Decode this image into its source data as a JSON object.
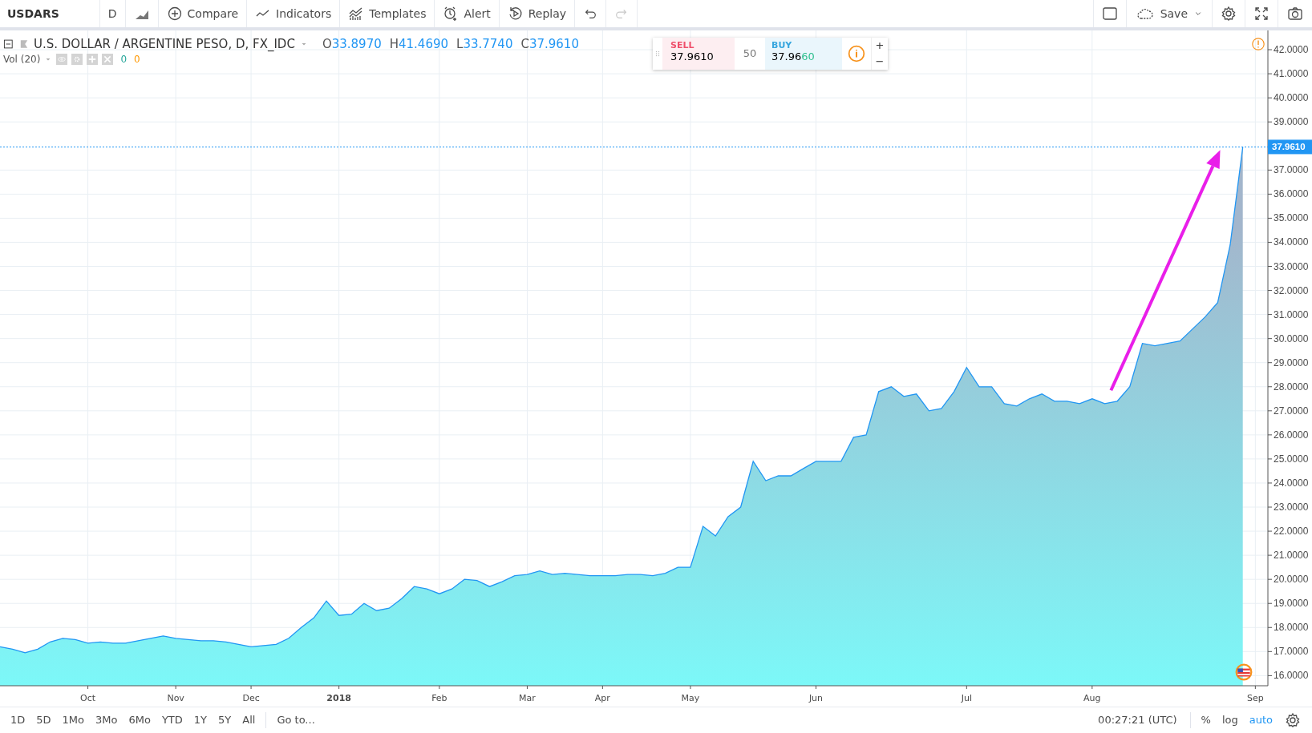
{
  "toolbar": {
    "symbol": "USDARS",
    "interval": "D",
    "buttons": [
      {
        "label": "Compare",
        "kind": "compare"
      },
      {
        "label": "Indicators",
        "kind": "indicators"
      },
      {
        "label": "Templates",
        "kind": "templates"
      },
      {
        "label": "Alert",
        "kind": "alert"
      },
      {
        "label": "Replay",
        "kind": "replay"
      }
    ],
    "undo": {
      "disabled": false
    },
    "redo": {
      "disabled": true
    },
    "save": {
      "label": "Save"
    }
  },
  "legend": {
    "title": "U.S. DOLLAR / ARGENTINE PESO, D, FX_IDC",
    "ohlc": [
      {
        "key": "O",
        "value": "33.8970"
      },
      {
        "key": "H",
        "value": "41.4690"
      },
      {
        "key": "L",
        "value": "33.7740"
      },
      {
        "key": "C",
        "value": "37.9610"
      }
    ],
    "study": {
      "label": "Vol (20)",
      "values": [
        {
          "value": "0",
          "color": "#26a69a"
        },
        {
          "value": "0",
          "color": "#ff9800"
        }
      ]
    }
  },
  "trade": {
    "sell": {
      "label": "SELL",
      "price": "37.9610"
    },
    "spread": "50",
    "buy": {
      "label": "BUY",
      "price_main": "37.96",
      "price_pips": "60"
    },
    "plus": "+",
    "minus": "−"
  },
  "chart": {
    "chart_data": {
      "type": "area",
      "categories": [
        null,
        null,
        null,
        null,
        null,
        null,
        null,
        "Oct",
        null,
        null,
        null,
        null,
        null,
        null,
        "Nov",
        null,
        null,
        null,
        null,
        null,
        "Dec",
        null,
        null,
        null,
        null,
        null,
        null,
        "2018",
        null,
        null,
        null,
        null,
        null,
        null,
        null,
        "Feb",
        null,
        null,
        null,
        null,
        null,
        null,
        "Mar",
        null,
        null,
        null,
        null,
        null,
        "Apr",
        null,
        null,
        null,
        null,
        null,
        null,
        "May",
        null,
        null,
        null,
        null,
        null,
        null,
        null,
        null,
        null,
        "Jun",
        null,
        null,
        null,
        null,
        null,
        null,
        null,
        null,
        null,
        null,
        null,
        "Jul",
        null,
        null,
        null,
        null,
        null,
        null,
        null,
        null,
        null,
        "Aug",
        null,
        null,
        null,
        null,
        null,
        null,
        null,
        null,
        null,
        null,
        null,
        null,
        "Sep"
      ],
      "series": [
        {
          "color": "#2196f3",
          "values": [
            17.2,
            17.1,
            16.95,
            17.1,
            17.4,
            17.55,
            17.5,
            17.35,
            17.4,
            17.35,
            17.35,
            17.45,
            17.55,
            17.65,
            17.55,
            17.5,
            17.45,
            17.45,
            17.4,
            17.3,
            17.2,
            17.25,
            17.3,
            17.55,
            18.0,
            18.4,
            19.1,
            18.5,
            18.55,
            19.0,
            18.7,
            18.8,
            19.2,
            19.7,
            19.6,
            19.4,
            19.6,
            20.0,
            19.95,
            19.7,
            19.9,
            20.15,
            20.2,
            20.35,
            20.2,
            20.25,
            20.2,
            20.15,
            20.15,
            20.15,
            20.2,
            20.2,
            20.15,
            20.25,
            20.5,
            20.5,
            22.2,
            21.8,
            22.6,
            23.0,
            24.9,
            24.1,
            24.3,
            24.3,
            24.6,
            24.9,
            24.9,
            24.9,
            25.9,
            26.0,
            27.8,
            28.0,
            27.6,
            27.7,
            27.0,
            27.1,
            27.8,
            28.8,
            28.0,
            28.0,
            27.3,
            27.2,
            27.5,
            27.7,
            27.4,
            27.4,
            27.3,
            27.5,
            27.3,
            27.4,
            28.0,
            29.8,
            29.7,
            29.8,
            29.9,
            30.4,
            30.9,
            31.5,
            33.9,
            37.96,
            null
          ]
        }
      ],
      "ylim": [
        15.58,
        42.8
      ],
      "yticks": [
        {
          "value": 16,
          "label": "16.0000"
        },
        {
          "value": 17,
          "label": "17.0000"
        },
        {
          "value": 18,
          "label": "18.0000"
        },
        {
          "value": 19,
          "label": "19.0000"
        },
        {
          "value": 20,
          "label": "20.0000"
        },
        {
          "value": 21,
          "label": "21.0000"
        },
        {
          "value": 22,
          "label": "22.0000"
        },
        {
          "value": 23,
          "label": "23.0000"
        },
        {
          "value": 24,
          "label": "24.0000"
        },
        {
          "value": 25,
          "label": "25.0000"
        },
        {
          "value": 26,
          "label": "26.0000"
        },
        {
          "value": 27,
          "label": "27.0000"
        },
        {
          "value": 28,
          "label": "28.0000"
        },
        {
          "value": 29,
          "label": "29.0000"
        },
        {
          "value": 30,
          "label": "30.0000"
        },
        {
          "value": 31,
          "label": "31.0000"
        },
        {
          "value": 32,
          "label": "32.0000"
        },
        {
          "value": 33,
          "label": "33.0000"
        },
        {
          "value": 34,
          "label": "34.0000"
        },
        {
          "value": 35,
          "label": "35.0000"
        },
        {
          "value": 36,
          "label": "36.0000"
        },
        {
          "value": 37,
          "label": "37.0000"
        },
        {
          "value": 39,
          "label": "39.0000"
        },
        {
          "value": 40,
          "label": "40.0000"
        },
        {
          "value": 41,
          "label": "41.0000"
        },
        {
          "value": 42,
          "label": "42.0000"
        }
      ],
      "grid": true,
      "ref_lines": [
        {
          "axis": "y",
          "value": 37.961,
          "label": "37.9610"
        }
      ]
    }
  },
  "bottom_bar": {
    "ranges": [
      "1D",
      "5D",
      "1Mo",
      "3Mo",
      "6Mo",
      "YTD",
      "1Y",
      "5Y",
      "All"
    ],
    "goto": "Go to...",
    "time": "00:27:21 (UTC)",
    "toggles": [
      {
        "label": "%",
        "selected": false
      },
      {
        "label": "log",
        "selected": false
      },
      {
        "label": "auto",
        "selected": true
      }
    ]
  }
}
